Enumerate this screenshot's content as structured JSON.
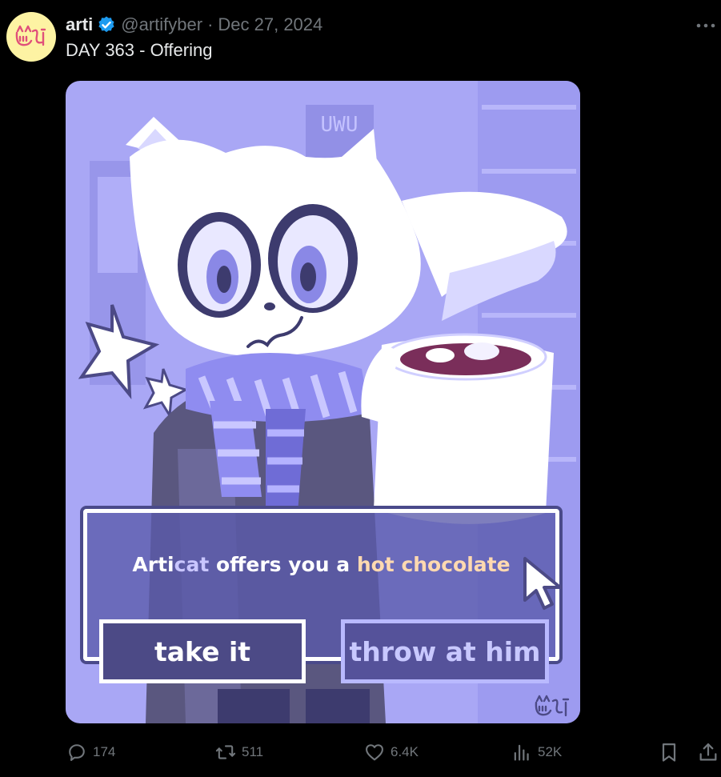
{
  "post": {
    "display_name": "arti",
    "handle": "@artifyber",
    "separator": "·",
    "date": "Dec 27, 2024",
    "text": "DAY 363 - Offering"
  },
  "image": {
    "sign_text": "UWU",
    "dialog": {
      "prefix": "Arti",
      "cat": "cat",
      "middle": " offers you a ",
      "highlight": "hot chocolate"
    },
    "options": [
      "take it",
      "throw at him"
    ]
  },
  "actions": {
    "reply": "174",
    "repost": "511",
    "like": "6.4K",
    "views": "52K"
  },
  "icons": {
    "verified": "verified-badge-icon",
    "more": "more-icon",
    "reply": "reply-icon",
    "repost": "repost-icon",
    "like": "heart-icon",
    "views": "views-icon",
    "bookmark": "bookmark-icon",
    "share": "share-icon"
  },
  "colors": {
    "background": "#000000",
    "text": "#e7e9ea",
    "muted": "#71767b",
    "verified": "#1d9bf0",
    "avatar_bg": "#fdf3a3",
    "art_bg": "#a9a7f5",
    "highlight": "#ffd9b0"
  }
}
